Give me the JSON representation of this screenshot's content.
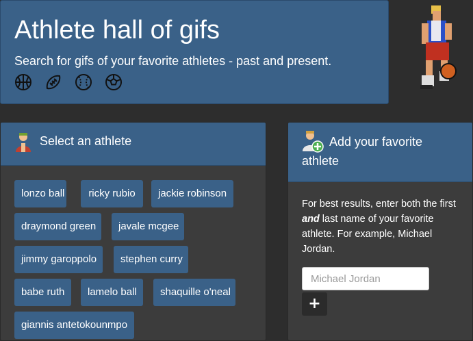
{
  "header": {
    "title": "Athlete hall of gifs",
    "subtitle": "Search for gifs of your favorite athletes - past and present.",
    "sport_icons": [
      "basketball-icon",
      "football-icon",
      "baseball-icon",
      "soccer-ball-icon"
    ]
  },
  "select_panel": {
    "title": "Select an athlete",
    "icon": "athlete-avatar-icon",
    "athletes": [
      "lonzo ball",
      "ricky rubio",
      "jackie robinson",
      "draymond green",
      "javale mcgee",
      "jimmy garoppolo",
      "stephen curry",
      "babe ruth",
      "lamelo ball",
      "shaquille o'neal",
      "giannis antetokounmpo"
    ]
  },
  "add_panel": {
    "title": "Add your favorite athlete",
    "icon": "add-athlete-icon",
    "help_before": "For best results, enter both the first ",
    "help_emphasis": "and",
    "help_after": " last name of your favorite athlete. For example, Michael Jordan.",
    "input_placeholder": "Michael Jordan",
    "input_value": "",
    "add_button_label": "+"
  },
  "colors": {
    "background": "#2d2d2d",
    "primary": "#3a6188",
    "panel": "#3c3c3c"
  }
}
